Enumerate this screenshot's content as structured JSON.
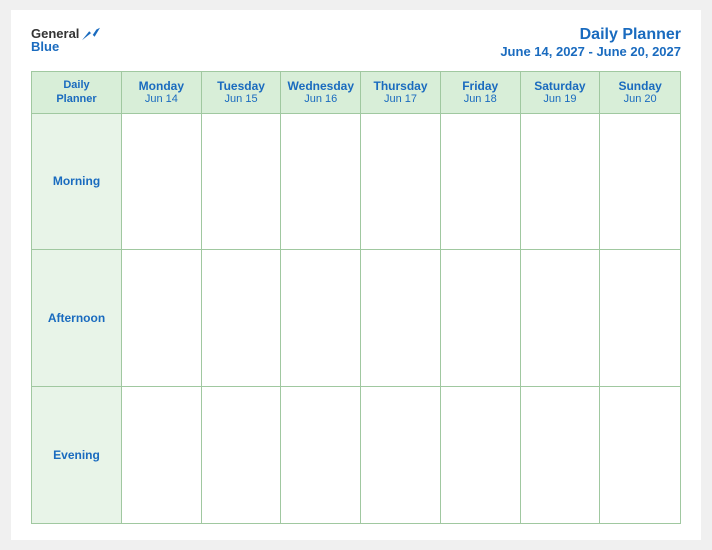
{
  "header": {
    "logo": {
      "general": "General",
      "blue": "Blue",
      "bird_alt": "bird icon"
    },
    "title": "Daily Planner",
    "date_range": "June 14, 2027 - June 20, 2027"
  },
  "calendar": {
    "planner_label_line1": "Daily",
    "planner_label_line2": "Planner",
    "days": [
      {
        "name": "Monday",
        "date": "Jun 14"
      },
      {
        "name": "Tuesday",
        "date": "Jun 15"
      },
      {
        "name": "Wednesday",
        "date": "Jun 16"
      },
      {
        "name": "Thursday",
        "date": "Jun 17"
      },
      {
        "name": "Friday",
        "date": "Jun 18"
      },
      {
        "name": "Saturday",
        "date": "Jun 19"
      },
      {
        "name": "Sunday",
        "date": "Jun 20"
      }
    ],
    "time_slots": [
      "Morning",
      "Afternoon",
      "Evening"
    ]
  }
}
